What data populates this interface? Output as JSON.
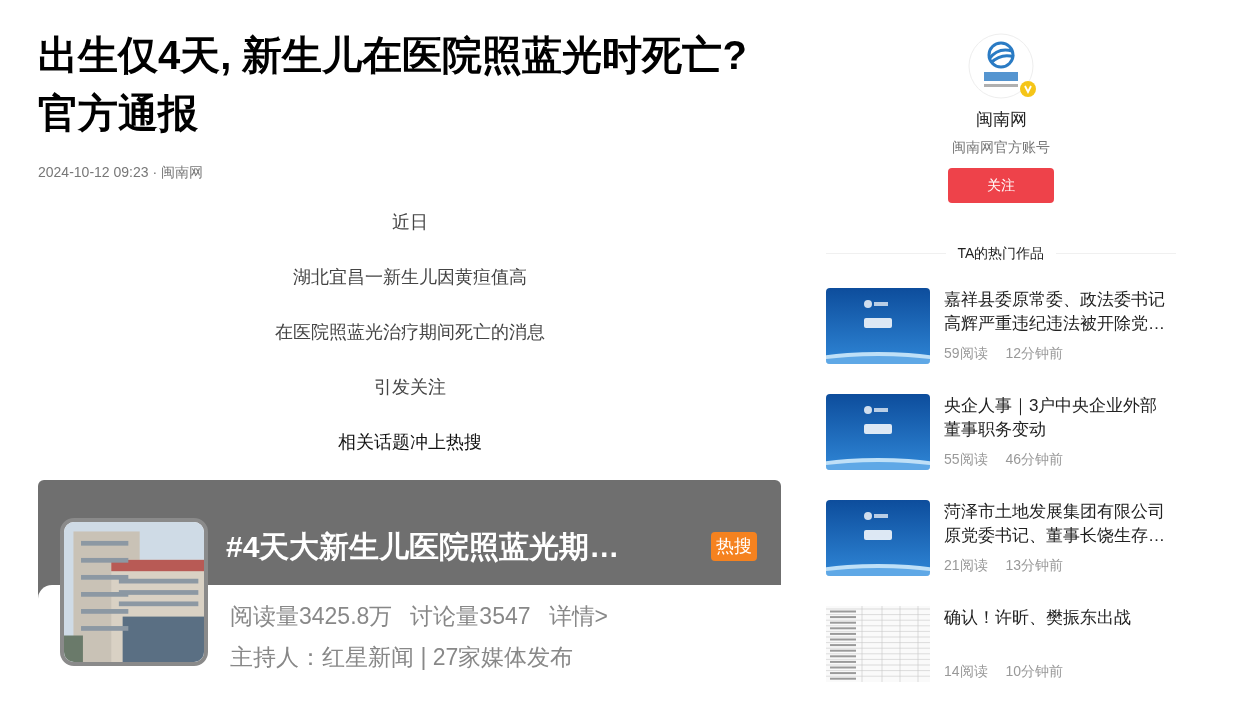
{
  "article": {
    "title": "出生仅4天, 新生儿在医院照蓝光时死亡? 官方通报",
    "meta": "2024-10-12 09:23 · 闽南网",
    "paragraphs": [
      "近日",
      "湖北宜昌一新生儿因黄疸值高",
      "在医院照蓝光治疗期间死亡的消息",
      "引发关注",
      "相关话题冲上热搜"
    ],
    "embedded_card": {
      "topic": "#4天大新生儿医院照蓝光期…",
      "tag": "热搜",
      "stats": [
        "阅读量3425.8万",
        "讨论量3547",
        "详情>"
      ],
      "host_line": "主持人：红星新闻 | 27家媒体发布"
    }
  },
  "author": {
    "name": "闽南网",
    "subtitle": "闽南网官方账号",
    "verified": true,
    "follow_button": "关注"
  },
  "hot_works": {
    "heading": "TA的热门作品",
    "items": [
      {
        "title": "嘉祥县委原常委、政法委书记高辉严重违纪违法被开除党…",
        "reads": "59阅读",
        "time": "12分钟前",
        "kind": "banner"
      },
      {
        "title": "央企人事｜3户中央企业外部董事职务变动",
        "reads": "55阅读",
        "time": "46分钟前",
        "kind": "banner"
      },
      {
        "title": "菏泽市土地发展集团有限公司原党委书记、董事长饶生存…",
        "reads": "21阅读",
        "time": "13分钟前",
        "kind": "banner"
      },
      {
        "title": "确认！许昕、樊振东出战",
        "reads": "14阅读",
        "time": "10分钟前",
        "kind": "document"
      }
    ]
  }
}
